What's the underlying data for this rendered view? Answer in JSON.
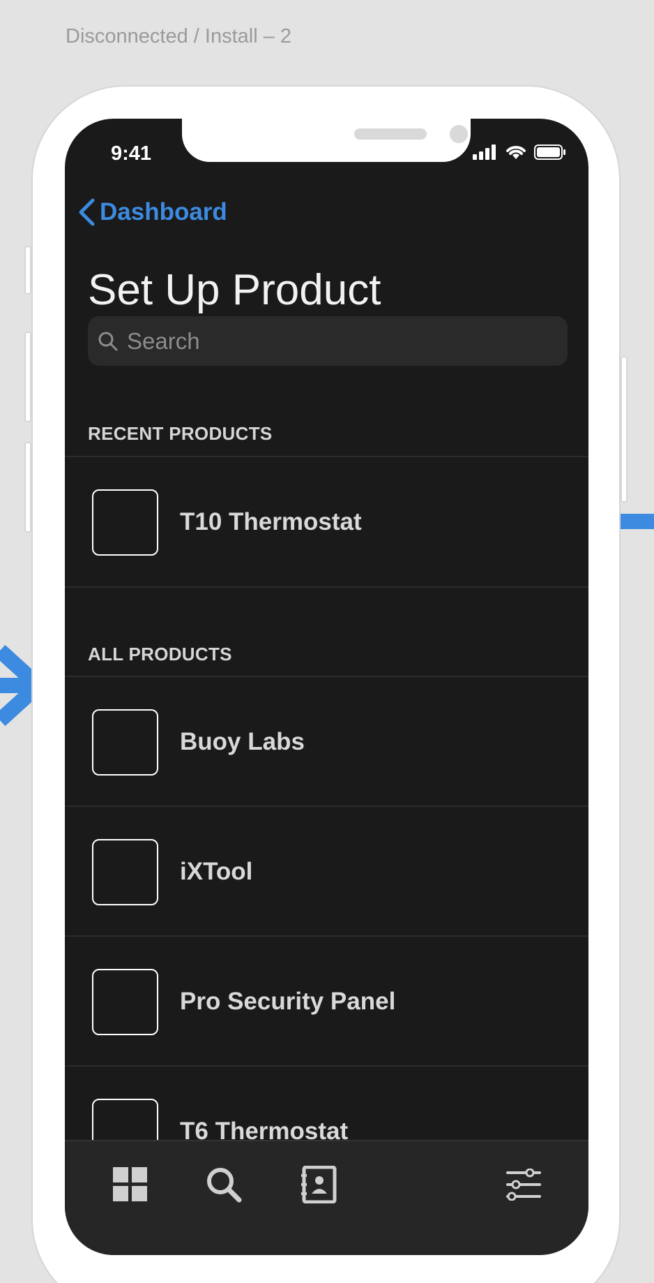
{
  "frame_label": "Disconnected / Install – 2",
  "status_bar": {
    "time": "9:41"
  },
  "nav": {
    "back_label": "Dashboard"
  },
  "page": {
    "title": "Set Up Product"
  },
  "search": {
    "placeholder": "Search"
  },
  "sections": {
    "recent": {
      "header": "RECENT PRODUCTS",
      "items": [
        {
          "label": "T10 Thermostat"
        }
      ]
    },
    "all": {
      "header": "ALL PRODUCTS",
      "items": [
        {
          "label": "Buoy Labs"
        },
        {
          "label": "iXTool"
        },
        {
          "label": "Pro Security Panel"
        },
        {
          "label": "T6 Thermostat"
        }
      ]
    }
  },
  "tab_bar": {
    "tabs": [
      {
        "icon": "grid-icon"
      },
      {
        "icon": "search-icon"
      },
      {
        "icon": "contacts-icon"
      },
      {
        "icon": "sliders-icon"
      }
    ]
  },
  "colors": {
    "accent": "#3d8be0",
    "screen_bg": "#1a1a1a",
    "canvas_bg": "#e3e3e3"
  }
}
